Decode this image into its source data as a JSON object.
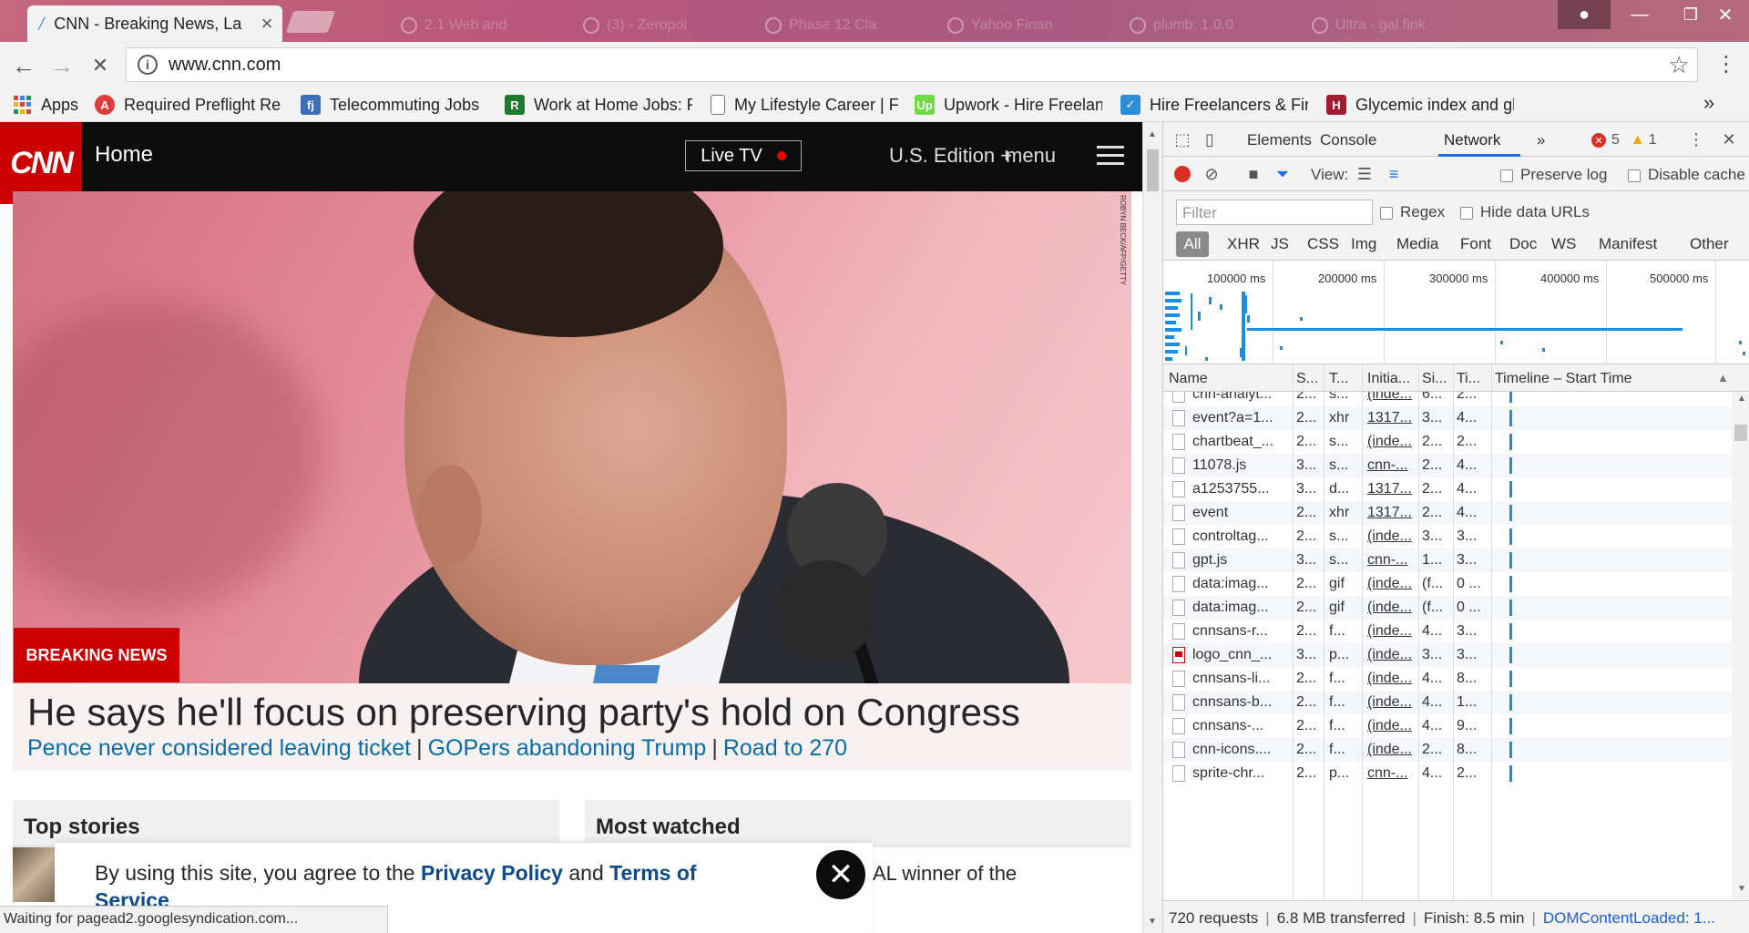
{
  "browser": {
    "active_tab": {
      "title": "CNN - Breaking News, La",
      "close": "×"
    },
    "background_tabs": [
      "2.1 Web and",
      "(3) - Zeropoi",
      "Phase 12 Cla",
      "Yahoo Finan",
      "plumb: 1.0.0",
      "Ultra - gal fink"
    ],
    "window_controls": {
      "minimize": "—",
      "restore": "❐",
      "close": "✕",
      "user": "●"
    },
    "back": "←",
    "forward": "→",
    "reload": "✕",
    "url": "www.cnn.com",
    "url_info": "i",
    "star": "☆",
    "menu": "⋮"
  },
  "bookmarks": {
    "items": [
      {
        "label": "Apps",
        "icon": "apps-grid-icon",
        "color": "#4285f4"
      },
      {
        "label": "Required Preflight Re",
        "icon": "adobe-icon",
        "color": "#e03a3a"
      },
      {
        "label": "Telecommuting Jobs",
        "icon": "flexjobs-icon",
        "color": "#3b6fb6"
      },
      {
        "label": "Work at Home Jobs: F",
        "icon": "green-icon",
        "color": "#1f7a2e"
      },
      {
        "label": "My Lifestyle Career | F",
        "icon": "page-icon",
        "color": "#ffffff"
      },
      {
        "label": "Upwork - Hire Freelan",
        "icon": "upwork-icon",
        "color": "#6fda44"
      },
      {
        "label": "Hire Freelancers & Fin",
        "icon": "freelancer-icon",
        "color": "#2a8fd6"
      },
      {
        "label": "Glycemic index and gl",
        "icon": "harvard-icon",
        "color": "#a41c30"
      }
    ],
    "more": "»"
  },
  "cnn": {
    "logo": "CNN",
    "home": "Home",
    "live_tv": "Live TV",
    "edition": "U.S. Edition +",
    "menu": "menu",
    "photo_credit": "ROBYN BECK/AFP/GETTY",
    "breaking": "BREAKING NEWS",
    "headline": "He says he'll focus on preserving party's hold on Congress",
    "sublinks": [
      "Pence never considered leaving ticket",
      "GOPers abandoning Trump",
      "Road to 270"
    ],
    "sublink_sep": "|",
    "top_stories": "Top stories",
    "most_watched": "Most watched",
    "most_watched_snippet": "AL winner of the",
    "consent": {
      "prefix": "By using this site, you agree to the ",
      "privacy": "Privacy Policy",
      "and": " and ",
      "terms": "Terms of",
      "terms2": "Service",
      "close": "✕"
    },
    "status": "Waiting for pagead2.googlesyndication.com..."
  },
  "devtools": {
    "tabs": [
      "Elements",
      "Console",
      "Network"
    ],
    "more_tabs": "»",
    "errors": "5",
    "warnings": "1",
    "view_label": "View:",
    "preserve_log": "Preserve log",
    "disable_cache": "Disable cache",
    "filter_placeholder": "Filter",
    "regex": "Regex",
    "hide_data_urls": "Hide data URLs",
    "types": [
      "All",
      "XHR",
      "JS",
      "CSS",
      "Img",
      "Media",
      "Font",
      "Doc",
      "WS",
      "Manifest",
      "Other"
    ],
    "overview_ticks": [
      "100000 ms",
      "200000 ms",
      "300000 ms",
      "400000 ms",
      "500000 ms"
    ],
    "columns": [
      "Name",
      "S...",
      "T...",
      "Initia...",
      "Si...",
      "Ti...",
      "Timeline – Start Time"
    ],
    "sort_arrow": "▲",
    "rows": [
      {
        "name": "cnn-analyt...",
        "status": "2...",
        "type": "s...",
        "init": "(inde...",
        "size": "6...",
        "time": "2...",
        "icon": "file"
      },
      {
        "name": "event?a=1...",
        "status": "2...",
        "type": "xhr",
        "init": "1317...",
        "size": "3...",
        "time": "4...",
        "icon": "file"
      },
      {
        "name": "chartbeat_...",
        "status": "2...",
        "type": "s...",
        "init": "(inde...",
        "size": "2...",
        "time": "2...",
        "icon": "file"
      },
      {
        "name": "11078.js",
        "status": "3...",
        "type": "s...",
        "init": "cnn-...",
        "size": "2...",
        "time": "4...",
        "icon": "file"
      },
      {
        "name": "a1253755...",
        "status": "3...",
        "type": "d...",
        "init": "1317...",
        "size": "2...",
        "time": "4...",
        "icon": "file"
      },
      {
        "name": "event",
        "status": "2...",
        "type": "xhr",
        "init": "1317...",
        "size": "2...",
        "time": "4...",
        "icon": "file"
      },
      {
        "name": "controltag...",
        "status": "2...",
        "type": "s...",
        "init": "(inde...",
        "size": "3...",
        "time": "3...",
        "icon": "file"
      },
      {
        "name": "gpt.js",
        "status": "3...",
        "type": "s...",
        "init": "cnn-...",
        "size": "1...",
        "time": "3...",
        "icon": "file"
      },
      {
        "name": "data:imag...",
        "status": "2...",
        "type": "gif",
        "init": "(inde...",
        "size": "(f...",
        "time": "0 ...",
        "icon": "file"
      },
      {
        "name": "data:imag...",
        "status": "2...",
        "type": "gif",
        "init": "(inde...",
        "size": "(f...",
        "time": "0 ...",
        "icon": "file"
      },
      {
        "name": "cnnsans-r...",
        "status": "2...",
        "type": "f...",
        "init": "(inde...",
        "size": "4...",
        "time": "3...",
        "icon": "file"
      },
      {
        "name": "logo_cnn_...",
        "status": "3...",
        "type": "p...",
        "init": "(inde...",
        "size": "3...",
        "time": "3...",
        "icon": "red"
      },
      {
        "name": "cnnsans-li...",
        "status": "2...",
        "type": "f...",
        "init": "(inde...",
        "size": "4...",
        "time": "8...",
        "icon": "file"
      },
      {
        "name": "cnnsans-b...",
        "status": "2...",
        "type": "f...",
        "init": "(inde...",
        "size": "4...",
        "time": "1...",
        "icon": "file"
      },
      {
        "name": "cnnsans-...",
        "status": "2...",
        "type": "f...",
        "init": "(inde...",
        "size": "4...",
        "time": "9...",
        "icon": "file"
      },
      {
        "name": "cnn-icons....",
        "status": "2...",
        "type": "f...",
        "init": "(inde...",
        "size": "2...",
        "time": "8...",
        "icon": "file"
      },
      {
        "name": "sprite-chr...",
        "status": "2...",
        "type": "p...",
        "init": "cnn-...",
        "size": "4...",
        "time": "2...",
        "icon": "file"
      }
    ],
    "summary": {
      "requests": "720 requests",
      "transferred": "6.8 MB transferred",
      "finish": "Finish: 8.5 min",
      "dcl": "DOMContentLoaded: 1..."
    }
  }
}
